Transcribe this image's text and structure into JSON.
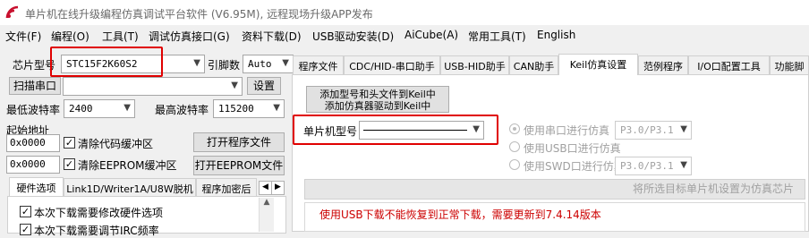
{
  "window": {
    "title": "单片机在线升级编程仿真调试平台软件 (V6.95M), 远程现场升级APP发布"
  },
  "menu": [
    "文件(F)",
    "编程(O)",
    "工具(T)",
    "调试仿真接口(G)",
    "资料下载(D)",
    "USB驱动安装(D)",
    "AiCube(A)",
    "常用工具(T)",
    "English"
  ],
  "left": {
    "chip_label": "芯片型号",
    "chip_value": "STC15F2K60S2",
    "pin_label": "引脚数",
    "pin_value": "Auto",
    "scan_button": "扫描串口",
    "port_value": "",
    "settings_button": "设置",
    "min_baud_label": "最低波特率",
    "min_baud_value": "2400",
    "max_baud_label": "最高波特率",
    "max_baud_value": "115200",
    "start_addr_label": "起始地址",
    "code_addr": "0x0000",
    "clear_code_label": "清除代码缓冲区",
    "eeprom_addr": "0x0000",
    "clear_eeprom_label": "清除EEPROM缓冲区",
    "open_program_button": "打开程序文件",
    "open_eeprom_button": "打开EEPROM文件",
    "tabs": [
      "硬件选项",
      "Link1D/Writer1A/U8W脱机",
      "程序加密后"
    ],
    "hw_options": [
      "本次下载需要修改硬件选项",
      "本次下载需要调节IRC频率"
    ]
  },
  "right": {
    "tabs": [
      "程序文件",
      "CDC/HID-串口助手",
      "USB-HID助手",
      "CAN助手",
      "Keil仿真设置",
      "范例程序",
      "I/O口配置工具",
      "功能脚"
    ],
    "add_keil_button_line1": "添加型号和头文件到Keil中",
    "add_keil_button_line2": "添加仿真器驱动到Keil中",
    "mcu_model_label": "单片机型号",
    "mcu_model_value": "",
    "radio_serial": "使用串口进行仿真",
    "serial_port_value": "P3.0/P3.1",
    "radio_usb": "使用USB口进行仿真",
    "radio_swd": "使用SWD口进行仿真",
    "swd_port_value": "P3.0/P3.1",
    "set_emulator_button": "将所选目标单片机设置为仿真芯片",
    "warning": "使用USB下载不能恢复到正常下载，需要更新到7.4.14版本"
  },
  "colors": {
    "highlight": "#e00000",
    "warning_text": "#cc0000"
  }
}
